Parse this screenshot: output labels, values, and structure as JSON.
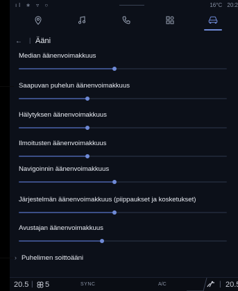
{
  "status_bar": {
    "left_icons": "ıl ∗ ▿ ○",
    "temperature": "16°C",
    "time": "20:2"
  },
  "app_bar": {
    "items": [
      {
        "icon": "location-pin-icon",
        "active": false
      },
      {
        "icon": "music-note-icon",
        "active": false
      },
      {
        "icon": "phone-icon",
        "active": false
      },
      {
        "icon": "apps-grid-icon",
        "active": false
      },
      {
        "icon": "car-icon",
        "active": true
      }
    ],
    "accent_color": "#6f8ad6"
  },
  "header": {
    "back_icon": "back-arrow-icon",
    "separator": "|",
    "title": "Ääni"
  },
  "settings": [
    {
      "label": "Median äänenvoimakkuus",
      "level": 0.46
    },
    {
      "label": "Saapuvan puhelun äänenvoimakkuus",
      "level": 0.33
    },
    {
      "label": "Hälytyksen äänenvoimakkuus",
      "level": 0.33
    },
    {
      "label": "Ilmoitusten äänenvoimakkuus",
      "level": 0.33
    },
    {
      "label": "Navigoinnin äänenvoimakkuus",
      "level": 0.46
    },
    {
      "label": "Järjestelmän äänenvoimakkuus (piippaukset ja kosketukset)",
      "level": 0.46
    },
    {
      "label": "Avustajan äänenvoimakkuus",
      "level": 0.4
    }
  ],
  "ringtone": {
    "chevron": "›",
    "label": "Puhelimen soittoääni"
  },
  "climate_bar": {
    "left_temp": "20.5",
    "separator": "|",
    "fan_speed": "5",
    "sync_label": "SYNC",
    "ac_label": "A/C",
    "right_temp": "20.5"
  }
}
